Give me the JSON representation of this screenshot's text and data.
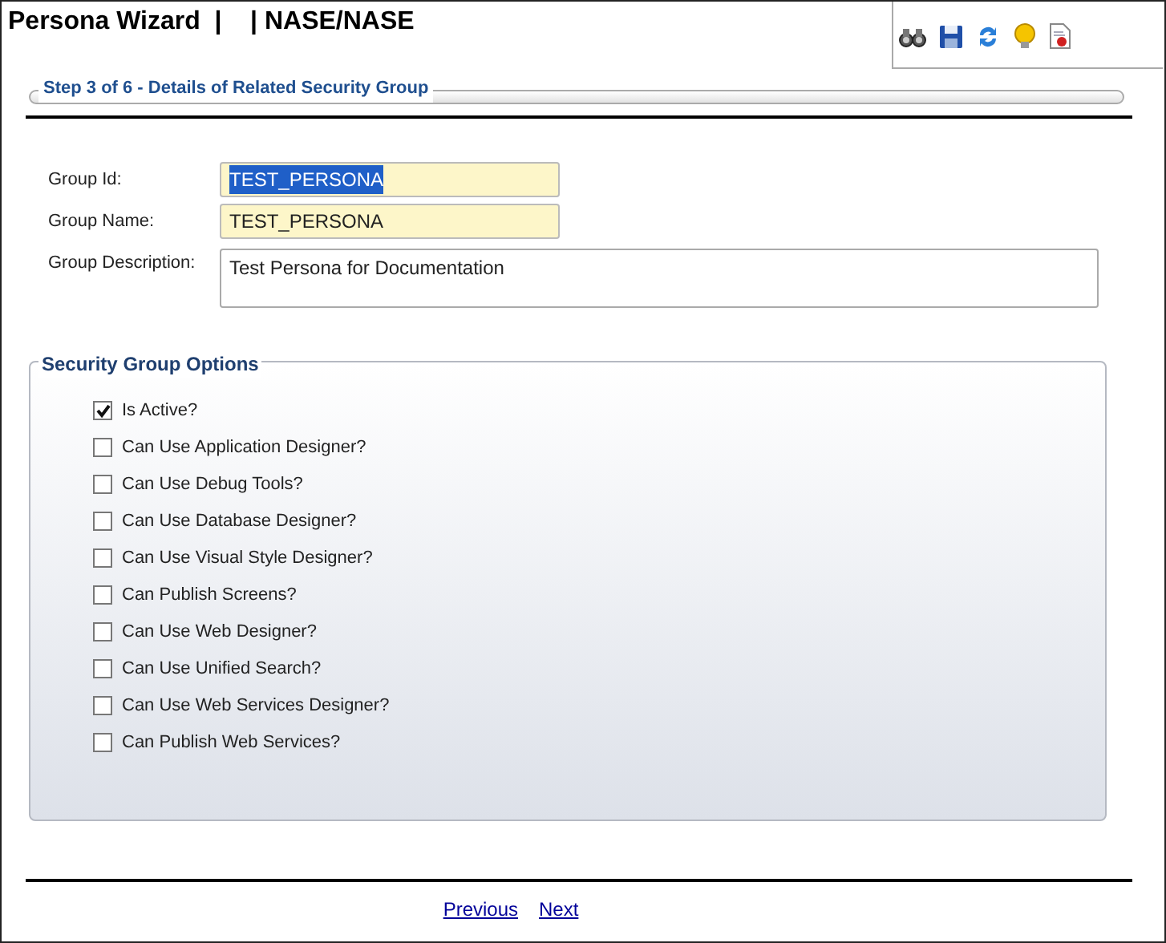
{
  "header": {
    "title": "Persona Wizard  |    | NASE/NASE"
  },
  "step": {
    "title": "Step 3 of 6 - Details of  Related Security Group"
  },
  "fields": [
    {
      "kind": "input",
      "label": "Group Id:",
      "value": "TEST_PERSONA",
      "text_selected": true
    },
    {
      "kind": "input",
      "label": "Group Name:",
      "value": "TEST_PERSONA",
      "text_selected": false
    },
    {
      "kind": "textarea",
      "label": "Group Description:",
      "value": "Test Persona for Documentation",
      "text_selected": false
    }
  ],
  "options": {
    "title": "Security Group Options",
    "items": [
      {
        "label": "Is Active?",
        "checked": true
      },
      {
        "label": "Can Use Application Designer?",
        "checked": false
      },
      {
        "label": "Can Use Debug Tools?",
        "checked": false
      },
      {
        "label": "Can Use Database Designer?",
        "checked": false
      },
      {
        "label": "Can Use Visual Style Designer?",
        "checked": false
      },
      {
        "label": "Can Publish Screens?",
        "checked": false
      },
      {
        "label": "Can Use Web Designer?",
        "checked": false
      },
      {
        "label": "Can Use Unified Search?",
        "checked": false
      },
      {
        "label": "Can Use Web Services Designer?",
        "checked": false
      },
      {
        "label": "Can Publish Web Services?",
        "checked": false
      }
    ]
  },
  "nav": [
    "Previous",
    "Next"
  ]
}
